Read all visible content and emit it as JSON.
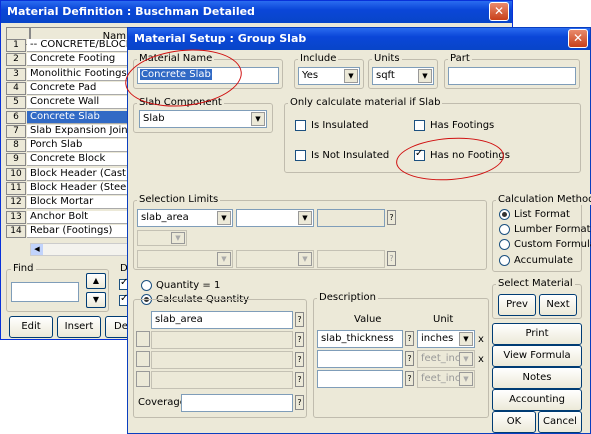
{
  "bg_window": {
    "title": "Material Definition : Buschman Detailed",
    "close": "✕",
    "col_header": "Nam",
    "rows": [
      {
        "n": "1",
        "label": "-- CONCRETE/BLOCK"
      },
      {
        "n": "2",
        "label": "Concrete Footing"
      },
      {
        "n": "3",
        "label": "Monolithic Footings"
      },
      {
        "n": "4",
        "label": "Concrete Pad"
      },
      {
        "n": "5",
        "label": "Concrete Wall"
      },
      {
        "n": "6",
        "label": "Concrete Slab"
      },
      {
        "n": "7",
        "label": "Slab Expansion Joint"
      },
      {
        "n": "8",
        "label": "Porch Slab"
      },
      {
        "n": "9",
        "label": "Concrete Block"
      },
      {
        "n": "10",
        "label": "Block Header (Cast)"
      },
      {
        "n": "11",
        "label": "Block Header (Steel)"
      },
      {
        "n": "12",
        "label": "Block Mortar"
      },
      {
        "n": "13",
        "label": "Anchor Bolt"
      },
      {
        "n": "14",
        "label": "Rebar (Footings)"
      }
    ],
    "selected_row": 6,
    "find_label": "Find",
    "d_label": "D",
    "edit": "Edit",
    "insert": "Insert",
    "del": "Del"
  },
  "dialog": {
    "title": "Material Setup :   Group  Slab",
    "close": "✕",
    "material_name_label": "Material Name",
    "material_name": "Concrete Slab",
    "include_label": "Include",
    "include_value": "Yes",
    "units_label": "Units",
    "units_value": "sqft",
    "part_label": "Part",
    "part_value": "",
    "slab_component_label": "Slab Component",
    "slab_component_value": "Slab",
    "only_calc_label": "Only calculate material if Slab",
    "cb_insulated": "Is Insulated",
    "cb_has_footings": "Has Footings",
    "cb_not_insulated": "Is Not Insulated",
    "cb_no_footings": "Has no Footings",
    "selection_limits_label": "Selection Limits",
    "sel_limit_1": "slab_area",
    "calc_method_label": "Calculation Method",
    "calc_methods": [
      "List Format",
      "Lumber Format",
      "Custom Formula",
      "Accumulate"
    ],
    "calc_method_selected": 0,
    "qty_one": "Quantity = 1",
    "calc_qty": "Calculate Quantity",
    "qty_value": "slab_area",
    "coverage_label": "Coverage",
    "coverage_value": "",
    "description_label": "Description",
    "value_header": "Value",
    "unit_header": "Unit",
    "desc_row1_value": "slab_thickness",
    "desc_row1_unit": "inches",
    "desc_row2_unit": "feet_inche",
    "desc_row3_unit": "feet_inche",
    "x_sym": "x",
    "q_sym": "?",
    "select_material_label": "Select Material",
    "prev": "Prev",
    "next": "Next",
    "print": "Print",
    "view_formula": "View Formula",
    "notes": "Notes",
    "accounting": "Accounting",
    "ok": "OK",
    "cancel": "Cancel"
  },
  "colors": {
    "title_blue": "#0a46d8",
    "selection": "#316ac5",
    "annotation_red": "#d01010"
  }
}
